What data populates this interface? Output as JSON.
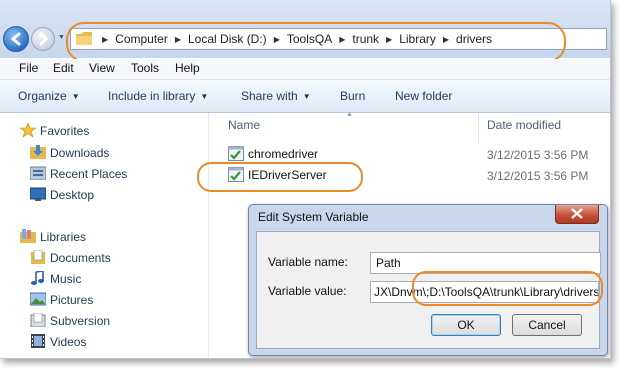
{
  "address_bar": {
    "breadcrumbs": [
      "Computer",
      "Local Disk (D:)",
      "ToolsQA",
      "trunk",
      "Library",
      "drivers"
    ]
  },
  "menu": {
    "items": [
      "File",
      "Edit",
      "View",
      "Tools",
      "Help"
    ]
  },
  "command_bar": {
    "organize": "Organize",
    "include_in_library": "Include in library",
    "share_with": "Share with",
    "burn": "Burn",
    "new_folder": "New folder"
  },
  "nav_pane": {
    "favorites_label": "Favorites",
    "favorites": [
      "Downloads",
      "Recent Places",
      "Desktop"
    ],
    "libraries_label": "Libraries",
    "libraries": [
      "Documents",
      "Music",
      "Pictures",
      "Subversion",
      "Videos"
    ]
  },
  "file_list": {
    "columns": {
      "name": "Name",
      "date_modified": "Date modified"
    },
    "rows": [
      {
        "name": "chromedriver",
        "date": "3/12/2015 3:56 PM"
      },
      {
        "name": "IEDriverServer",
        "date": "3/12/2015 3:56 PM"
      }
    ]
  },
  "dialog": {
    "title": "Edit System Variable",
    "variable_name_label": "Variable name:",
    "variable_name_value": "Path",
    "variable_value_label": "Variable value:",
    "variable_value_value": "JX\\Dnvm\\;D:\\ToolsQA\\trunk\\Library\\drivers",
    "ok_label": "OK",
    "cancel_label": "Cancel"
  },
  "colors": {
    "highlight": "#ec8a2a",
    "dialog_frame": "#c8d7eb",
    "close_button": "#c6533d"
  },
  "icons": {
    "back": "back-arrow-icon",
    "forward": "forward-arrow-icon",
    "folder": "folder-icon",
    "favorites": "star-icon",
    "downloads": "downloads-folder-icon",
    "recent": "recent-places-icon",
    "desktop": "desktop-icon",
    "libraries": "libraries-icon",
    "documents": "documents-icon",
    "music": "music-icon",
    "pictures": "pictures-icon",
    "subversion": "subversion-icon",
    "videos": "videos-icon",
    "executable": "executable-icon",
    "close": "close-icon"
  }
}
